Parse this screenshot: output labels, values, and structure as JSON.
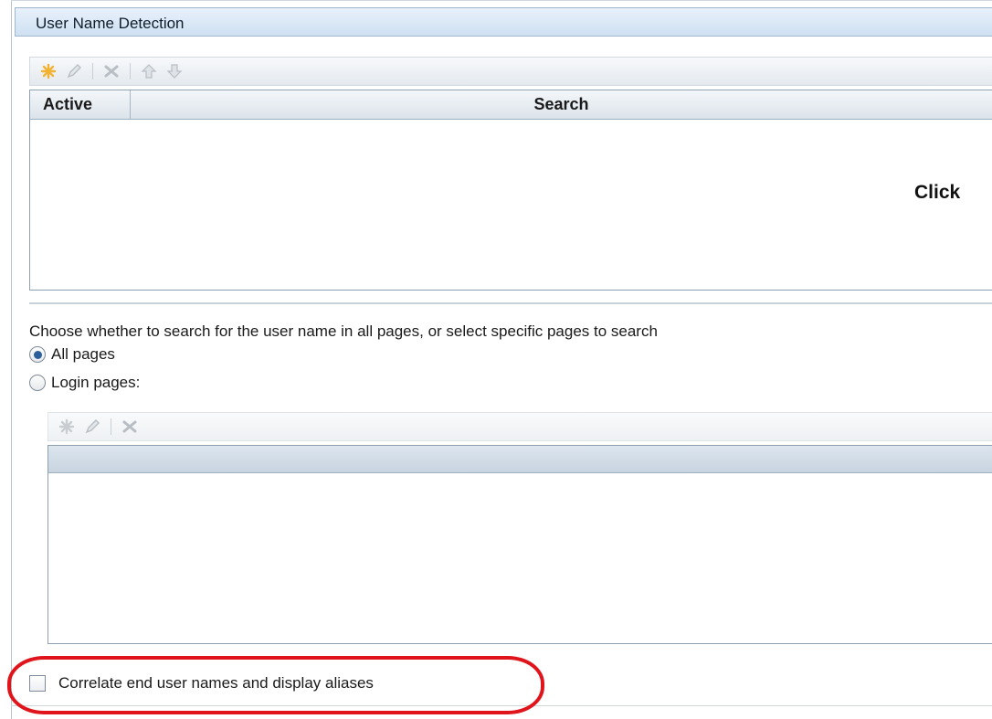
{
  "section": {
    "title": "User Name Detection"
  },
  "toolbar1": {
    "buttons": [
      {
        "icon": "new-star-icon",
        "color": "#f2b233"
      },
      {
        "icon": "edit-pencil-icon",
        "color": "#b8bec4"
      },
      {
        "icon": "delete-x-icon",
        "color": "#b8bec4"
      },
      {
        "icon": "move-up-arrow-icon",
        "color": "#b8bec4"
      },
      {
        "icon": "move-down-arrow-icon",
        "color": "#b8bec4"
      }
    ]
  },
  "grid1": {
    "columns": [
      "Active",
      "Search"
    ],
    "rows": [],
    "hint": "Click"
  },
  "page_scope": {
    "prompt": "Choose whether to search for the user name in all pages, or select specific pages to search",
    "options": [
      {
        "label": "All pages",
        "selected": true
      },
      {
        "label": "Login pages:",
        "selected": false
      }
    ]
  },
  "toolbar2": {
    "buttons": [
      {
        "icon": "new-star-icon",
        "color": "#c9cdd1"
      },
      {
        "icon": "edit-pencil-icon",
        "color": "#b8bec4"
      },
      {
        "icon": "delete-x-icon",
        "color": "#b8bec4"
      }
    ]
  },
  "grid2": {
    "rows": []
  },
  "correlate": {
    "label": "Correlate end user names and display aliases",
    "checked": false
  },
  "highlight_color": "#e0151c",
  "header_accent": "#cfe0f1"
}
